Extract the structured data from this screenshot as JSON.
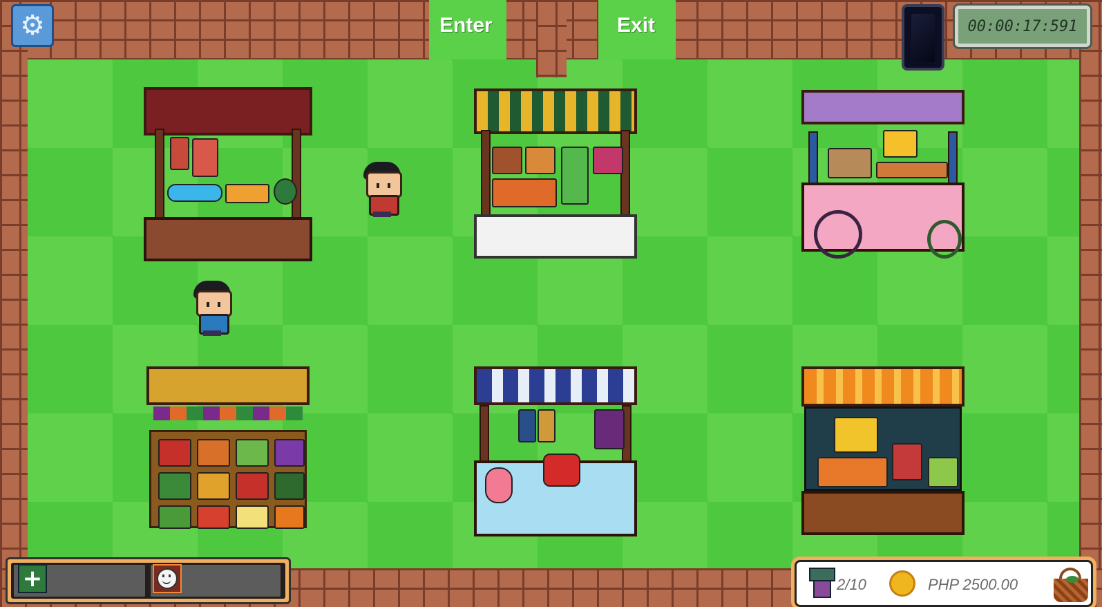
{
  "doors": {
    "enter_label": "Enter",
    "exit_label": "Exit"
  },
  "hud": {
    "timer": "00:00:17:591",
    "settings_icon": "gear-icon",
    "phone_icon": "phone-icon",
    "hotbar": {
      "slot1_icon": "plus-icon",
      "slot2_icon": "smiley-face-icon"
    },
    "stats": {
      "stalls_visited": "2/10",
      "money": "PHP 2500.00",
      "stalls_icon": "stall-icon",
      "coin_icon": "coin-icon",
      "basket_icon": "basket-icon"
    }
  },
  "colors": {
    "floor": "#5fd14b",
    "wall": "#b46a4c",
    "hotbar_frame": "#f0b060",
    "timer_bg": "#7aa07a"
  }
}
